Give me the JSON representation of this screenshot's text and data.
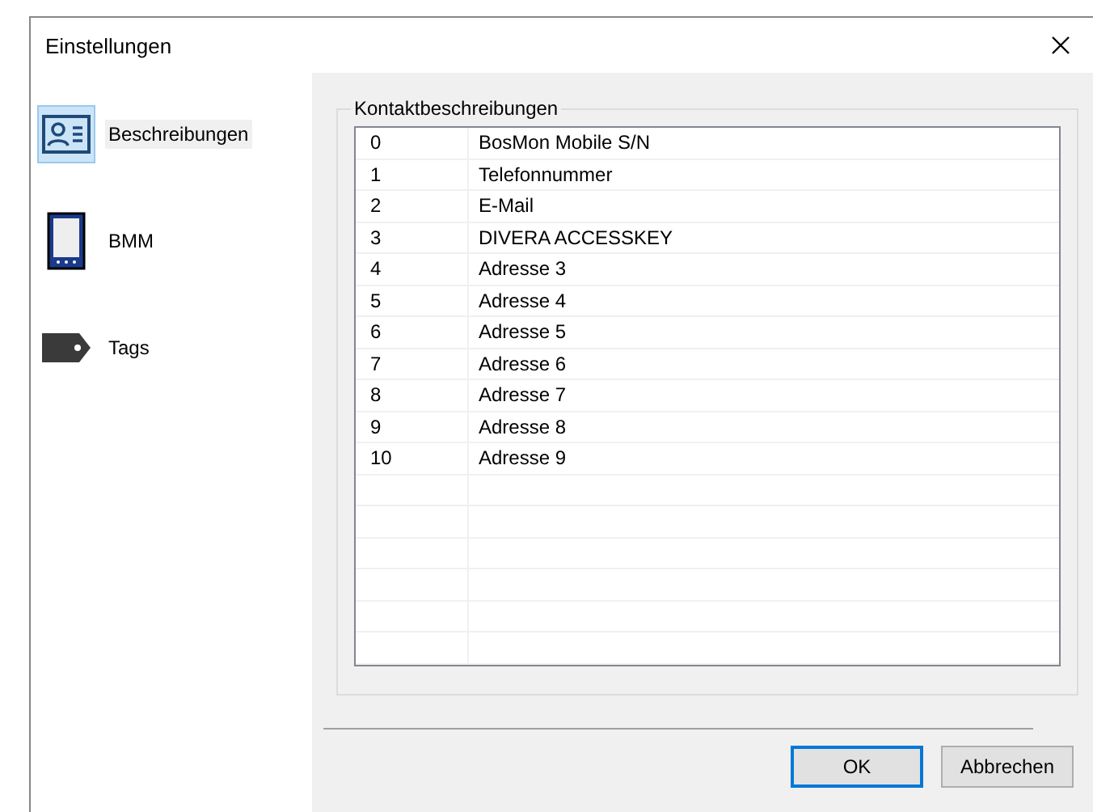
{
  "window": {
    "title": "Einstellungen"
  },
  "sidebar": {
    "items": [
      {
        "kind": "card",
        "label": "Beschreibungen",
        "selected": true
      },
      {
        "kind": "device",
        "label": "BMM",
        "selected": false
      },
      {
        "kind": "tag",
        "label": "Tags",
        "selected": false
      }
    ]
  },
  "group": {
    "title": "Kontaktbeschreibungen"
  },
  "table": {
    "rows": [
      [
        "0",
        "BosMon Mobile S/N"
      ],
      [
        "1",
        "Telefonnummer"
      ],
      [
        "2",
        "E-Mail"
      ],
      [
        "3",
        "DIVERA ACCESSKEY"
      ],
      [
        "4",
        "Adresse 3"
      ],
      [
        "5",
        "Adresse 4"
      ],
      [
        "6",
        "Adresse 5"
      ],
      [
        "7",
        "Adresse 6"
      ],
      [
        "8",
        "Adresse 7"
      ],
      [
        "9",
        "Adresse 8"
      ],
      [
        "10",
        "Adresse 9"
      ]
    ]
  },
  "buttons": [
    {
      "label": "OK",
      "default": true
    },
    {
      "label": "Abbrechen",
      "default": false
    }
  ]
}
